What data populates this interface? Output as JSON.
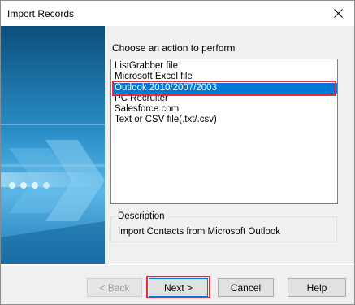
{
  "window": {
    "title": "Import Records"
  },
  "main": {
    "prompt": "Choose an action to perform",
    "options": [
      "ListGrabber file",
      "Microsoft Excel file",
      "Outlook 2010/2007/2003",
      "PC Recruiter",
      "Salesforce.com",
      "Text or CSV file(.txt/.csv)"
    ],
    "selected_index": 2,
    "description": {
      "label": "Description",
      "text": "Import Contacts from Microsoft Outlook"
    }
  },
  "buttons": {
    "back": "< Back",
    "next": "Next >",
    "cancel": "Cancel",
    "help": "Help"
  },
  "colors": {
    "selection": "#0078d7",
    "highlight_outline": "#e0303b",
    "banner_dark": "#0a5b8a",
    "banner_light": "#7fc6ea"
  }
}
